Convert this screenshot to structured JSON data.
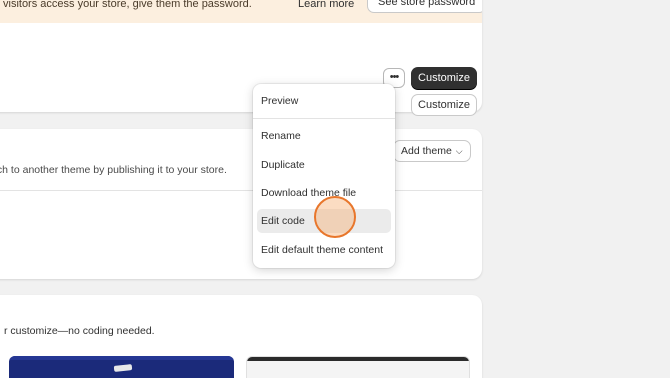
{
  "banner": {
    "text": "visitors access your store, give them the password.",
    "learn_more": "Learn more",
    "see_password": "See store password"
  },
  "current_theme": {
    "more_label": "•••",
    "customize_label": "Customize"
  },
  "menu": {
    "items": [
      {
        "label": "Preview"
      },
      {
        "label": "Rename"
      },
      {
        "label": "Duplicate"
      },
      {
        "label": "Download theme file"
      },
      {
        "label": "Edit code"
      },
      {
        "label": "Edit default theme content"
      }
    ]
  },
  "library": {
    "description": "tch to another theme by publishing it to your store.",
    "add_theme_label": "Add theme",
    "add_theme_icon": "chevron-down-icon",
    "customize_label": "Customize"
  },
  "popular": {
    "description": "r customize—no coding needed."
  },
  "colors": {
    "banner_bg": "#fcefdf",
    "primary_button": "#303030",
    "click_indicator": "#e8762b"
  }
}
